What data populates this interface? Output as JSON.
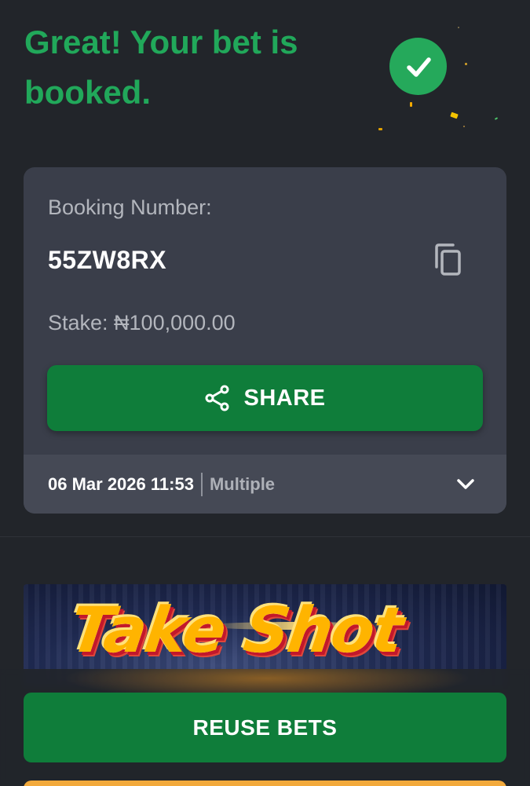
{
  "header": {
    "title": "Great! Your bet is booked."
  },
  "booking": {
    "number_label": "Booking Number:",
    "number": "55ZW8RX",
    "stake": "Stake: ₦100,000.00",
    "share_label": "SHARE",
    "date": "06 Mar 2026 11:53",
    "bet_type": "Multiple"
  },
  "banner": {
    "text": "Take Shot"
  },
  "actions": {
    "reuse_label": "REUSE BETS"
  },
  "icons": {
    "success": "check-circle-icon",
    "copy": "copy-icon",
    "share": "share-icon",
    "expand": "chevron-down-icon"
  },
  "colors": {
    "background": "#22252a",
    "card": "#3a3e4a",
    "card_footer": "#454955",
    "accent_green": "#21a85a",
    "button_green": "#0f7d3a",
    "secondary_orange": "#f2a93b"
  }
}
